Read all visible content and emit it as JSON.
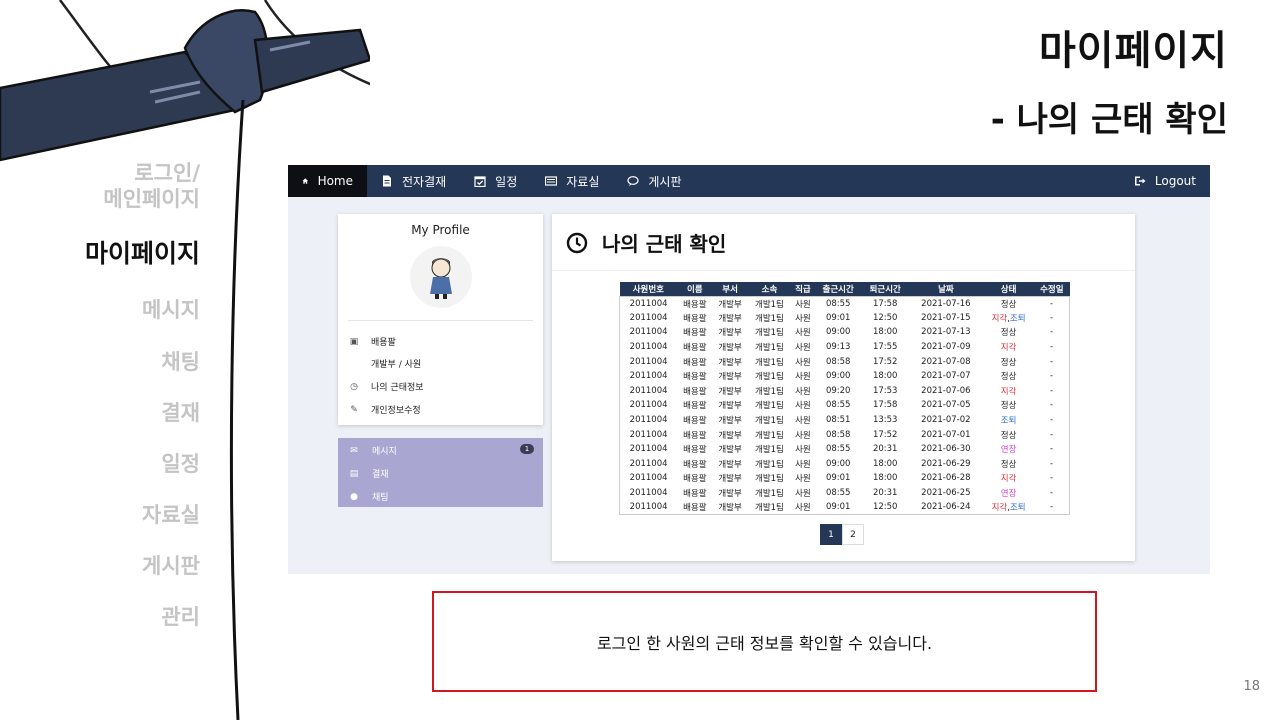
{
  "slide": {
    "title": "마이페이지",
    "subtitle": "- 나의 근태 확인",
    "caption": "로그인 한 사원의 근태 정보를 확인할 수 있습니다.",
    "page_number": "18"
  },
  "left_nav": [
    {
      "label": "로그인/\n메인페이지",
      "active": false
    },
    {
      "label": "마이페이지",
      "active": true
    },
    {
      "label": "메시지",
      "active": false
    },
    {
      "label": "채팅",
      "active": false
    },
    {
      "label": "결재",
      "active": false
    },
    {
      "label": "일정",
      "active": false
    },
    {
      "label": "자료실",
      "active": false
    },
    {
      "label": "게시판",
      "active": false
    },
    {
      "label": "관리",
      "active": false
    }
  ],
  "topbar": {
    "home": "Home",
    "approval": "전자결재",
    "schedule": "일정",
    "archive": "자료실",
    "board": "게시판",
    "logout": "Logout"
  },
  "profile": {
    "title": "My Profile",
    "name": "배용팔",
    "dept_rank": "개발부 / 사원",
    "attendance_link": "나의 근태정보",
    "edit_link": "개인정보수정"
  },
  "side_menu": {
    "message": "메시지",
    "message_count": "1",
    "approval": "결재",
    "chat": "채팅"
  },
  "attendance": {
    "title": "나의 근태 확인",
    "columns": [
      "사원번호",
      "이름",
      "부서",
      "소속",
      "직급",
      "출근시간",
      "퇴근시간",
      "날짜",
      "상태",
      "수정일"
    ],
    "rows": [
      [
        "2011004",
        "배용팔",
        "개발부",
        "개발1팀",
        "사원",
        "08:55",
        "17:58",
        "2021-07-16",
        "정상",
        "-"
      ],
      [
        "2011004",
        "배용팔",
        "개발부",
        "개발1팀",
        "사원",
        "09:01",
        "12:50",
        "2021-07-15",
        "지각,조퇴",
        "-"
      ],
      [
        "2011004",
        "배용팔",
        "개발부",
        "개발1팀",
        "사원",
        "09:00",
        "18:00",
        "2021-07-13",
        "정상",
        "-"
      ],
      [
        "2011004",
        "배용팔",
        "개발부",
        "개발1팀",
        "사원",
        "09:13",
        "17:55",
        "2021-07-09",
        "지각",
        "-"
      ],
      [
        "2011004",
        "배용팔",
        "개발부",
        "개발1팀",
        "사원",
        "08:58",
        "17:52",
        "2021-07-08",
        "정상",
        "-"
      ],
      [
        "2011004",
        "배용팔",
        "개발부",
        "개발1팀",
        "사원",
        "09:00",
        "18:00",
        "2021-07-07",
        "정상",
        "-"
      ],
      [
        "2011004",
        "배용팔",
        "개발부",
        "개발1팀",
        "사원",
        "09:20",
        "17:53",
        "2021-07-06",
        "지각",
        "-"
      ],
      [
        "2011004",
        "배용팔",
        "개발부",
        "개발1팀",
        "사원",
        "08:55",
        "17:58",
        "2021-07-05",
        "정상",
        "-"
      ],
      [
        "2011004",
        "배용팔",
        "개발부",
        "개발1팀",
        "사원",
        "08:51",
        "13:53",
        "2021-07-02",
        "조퇴",
        "-"
      ],
      [
        "2011004",
        "배용팔",
        "개발부",
        "개발1팀",
        "사원",
        "08:58",
        "17:52",
        "2021-07-01",
        "정상",
        "-"
      ],
      [
        "2011004",
        "배용팔",
        "개발부",
        "개발1팀",
        "사원",
        "08:55",
        "20:31",
        "2021-06-30",
        "연장",
        "-"
      ],
      [
        "2011004",
        "배용팔",
        "개발부",
        "개발1팀",
        "사원",
        "09:00",
        "18:00",
        "2021-06-29",
        "정상",
        "-"
      ],
      [
        "2011004",
        "배용팔",
        "개발부",
        "개발1팀",
        "사원",
        "09:01",
        "18:00",
        "2021-06-28",
        "지각",
        "-"
      ],
      [
        "2011004",
        "배용팔",
        "개발부",
        "개발1팀",
        "사원",
        "08:55",
        "20:31",
        "2021-06-25",
        "연장",
        "-"
      ],
      [
        "2011004",
        "배용팔",
        "개발부",
        "개발1팀",
        "사원",
        "09:01",
        "12:50",
        "2021-06-24",
        "지각,조퇴",
        "-"
      ]
    ],
    "pages": [
      "1",
      "2"
    ],
    "current_page": "1"
  },
  "colors": {
    "navbar": "#243756",
    "home_tab": "#0d0f14",
    "menu_card": "#a9a7d1",
    "late": "#e0303a",
    "early_leave": "#2f6fd6",
    "overtime": "#d23fd0",
    "caption_border": "#d0181e"
  },
  "icons": {
    "home": "home-icon",
    "approval": "document-icon",
    "schedule": "calendar-check-icon",
    "archive": "list-icon",
    "board": "chat-bubble-icon",
    "logout": "logout-icon",
    "attendance_title": "clock-icon"
  }
}
